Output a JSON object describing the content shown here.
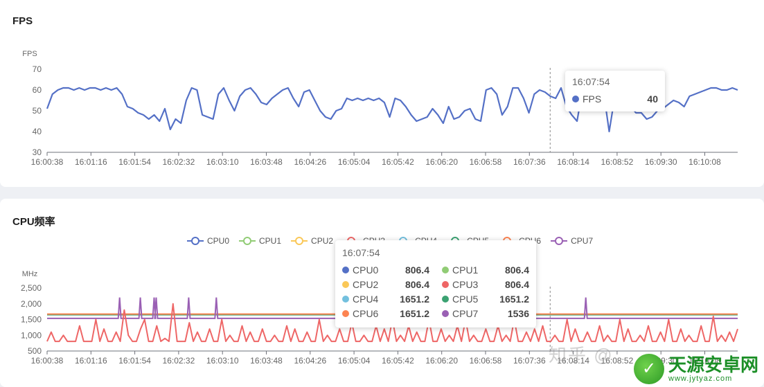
{
  "panels": {
    "fps_title": "FPS",
    "cpu_title": "CPU频率"
  },
  "chart_data": [
    {
      "type": "line",
      "title": "FPS",
      "ylabel": "FPS",
      "ylim": [
        30,
        70
      ],
      "yticks": [
        "70",
        "60",
        "50",
        "40",
        "30"
      ],
      "xticks": [
        "16:00:38",
        "16:01:16",
        "16:01:54",
        "16:02:32",
        "16:03:10",
        "16:03:48",
        "16:04:26",
        "16:05:04",
        "16:05:42",
        "16:06:20",
        "16:06:58",
        "16:07:36",
        "16:08:14",
        "16:08:52",
        "16:09:30",
        "16:10:08"
      ],
      "grid": false,
      "series": [
        {
          "name": "FPS",
          "color": "#5470c6",
          "values": [
            51,
            58,
            60,
            61,
            61,
            60,
            61,
            60,
            61,
            61,
            60,
            61,
            60,
            61,
            58,
            52,
            51,
            49,
            48,
            46,
            48,
            45,
            51,
            41,
            46,
            44,
            55,
            61,
            60,
            48,
            47,
            46,
            58,
            61,
            55,
            50,
            57,
            60,
            61,
            58,
            54,
            53,
            56,
            58,
            60,
            61,
            56,
            52,
            59,
            60,
            55,
            50,
            47,
            46,
            50,
            51,
            56,
            55,
            56,
            55,
            56,
            55,
            56,
            54,
            47,
            56,
            55,
            52,
            48,
            45,
            46,
            47,
            51,
            48,
            44,
            52,
            46,
            47,
            50,
            51,
            46,
            45,
            60,
            61,
            58,
            48,
            52,
            61,
            61,
            56,
            49,
            58,
            60,
            59,
            57,
            56,
            61,
            52,
            48,
            45,
            60,
            61,
            56,
            60,
            58,
            40,
            56,
            60,
            60,
            52,
            49,
            49,
            46,
            47,
            50,
            51,
            53,
            55,
            54,
            52,
            57,
            58,
            59,
            60,
            61,
            61,
            60,
            60,
            61,
            60
          ]
        }
      ],
      "tooltip": {
        "time": "16:07:54",
        "series": "FPS",
        "value": "40"
      }
    },
    {
      "type": "line",
      "title": "CPU频率",
      "ylabel": "MHz",
      "ylim": [
        500,
        2500
      ],
      "yticks": [
        "2,500",
        "2,000",
        "1,500",
        "1,000",
        "500"
      ],
      "xticks": [
        "16:00:38",
        "16:01:16",
        "16:01:54",
        "16:02:32",
        "16:03:10",
        "16:03:48",
        "16:04:26",
        "16:05:04",
        "16:05:42",
        "16:06:20",
        "16:06:58",
        "16:07:36",
        "16:08:14",
        "16:08:52",
        "16:09:30",
        "16:10:08"
      ],
      "legend": "top",
      "series": [
        {
          "name": "CPU0",
          "color": "#5470c6"
        },
        {
          "name": "CPU1",
          "color": "#91cc75"
        },
        {
          "name": "CPU2",
          "color": "#fac858"
        },
        {
          "name": "CPU3",
          "color": "#ee6666"
        },
        {
          "name": "CPU4",
          "color": "#73c0de"
        },
        {
          "name": "CPU5",
          "color": "#3ba272"
        },
        {
          "name": "CPU6",
          "color": "#fc8452"
        },
        {
          "name": "CPU7",
          "color": "#9a60b4"
        }
      ],
      "levels": {
        "CPU4_5": 1651.2,
        "CPU6": 1651.2,
        "CPU7": 1536,
        "CPU0_3_base": 806.4
      },
      "cpu7_spikes": [
        0.105,
        0.135,
        0.155,
        0.158,
        0.205,
        0.245,
        0.59,
        0.78
      ],
      "cpu03_values": [
        806,
        1100,
        806,
        806,
        1000,
        806,
        806,
        806,
        1300,
        806,
        806,
        806,
        1500,
        806,
        1200,
        806,
        806,
        1100,
        806,
        1800,
        1000,
        806,
        806,
        1200,
        1500,
        806,
        806,
        1300,
        806,
        900,
        806,
        2000,
        806,
        806,
        806,
        1400,
        806,
        1100,
        806,
        806,
        1200,
        806,
        806,
        1500,
        806,
        1000,
        806,
        806,
        1300,
        806,
        1100,
        806,
        806,
        1200,
        806,
        806,
        1000,
        806,
        806,
        1300,
        806,
        1200,
        806,
        806,
        1100,
        806,
        806,
        1500,
        806,
        1000,
        806,
        806,
        1200,
        806,
        806,
        1400,
        806,
        806,
        1000,
        806,
        806,
        1300,
        806,
        1200,
        806,
        1500,
        806,
        1000,
        806,
        1300,
        806,
        1100,
        806,
        806,
        1500,
        806,
        806,
        1200,
        806,
        1000,
        806,
        1300,
        806,
        1500,
        806,
        1000,
        806,
        806,
        1200,
        806,
        806,
        1300,
        806,
        1000,
        806,
        1500,
        806,
        806,
        1100,
        806,
        1200,
        806,
        1300,
        806,
        806,
        1000,
        806,
        806,
        1500,
        806,
        1200,
        806,
        806,
        1100,
        806,
        806,
        1300,
        806,
        1000,
        806,
        806,
        1500,
        806,
        1200,
        806,
        806,
        1000,
        806,
        1300,
        806,
        806,
        1100,
        806,
        1500,
        806,
        806,
        1200,
        806,
        1000,
        806,
        806,
        1300,
        806,
        806,
        1600,
        806,
        1000,
        806,
        1100,
        806,
        1200
      ],
      "tooltip": {
        "time": "16:07:54",
        "rows": [
          {
            "name": "CPU0",
            "value": "806.4",
            "color": "#5470c6"
          },
          {
            "name": "CPU1",
            "value": "806.4",
            "color": "#91cc75"
          },
          {
            "name": "CPU2",
            "value": "806.4",
            "color": "#fac858"
          },
          {
            "name": "CPU3",
            "value": "806.4",
            "color": "#ee6666"
          },
          {
            "name": "CPU4",
            "value": "1651.2",
            "color": "#73c0de"
          },
          {
            "name": "CPU5",
            "value": "1651.2",
            "color": "#3ba272"
          },
          {
            "name": "CPU6",
            "value": "1651.2",
            "color": "#fc8452"
          },
          {
            "name": "CPU7",
            "value": "1536",
            "color": "#9a60b4"
          }
        ]
      }
    }
  ],
  "watermark": {
    "zhihu": "知乎 @",
    "brand_name": "天源安卓网",
    "brand_url": "www.jytyaz.com"
  }
}
